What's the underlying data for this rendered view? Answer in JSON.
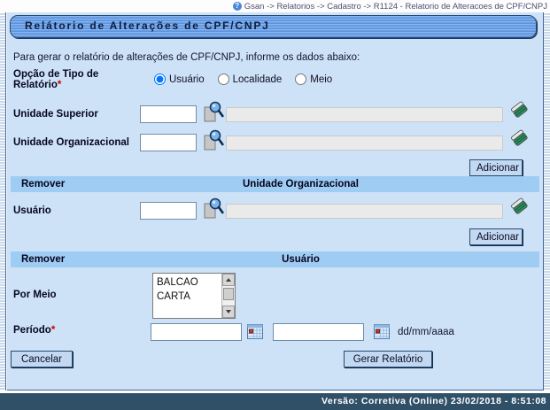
{
  "breadcrumb": {
    "text": "Gsan -> Relatorios -> Cadastro -> R1124 - Relatorio de Alteracoes de CPF/CNPJ",
    "help_glyph": "?"
  },
  "title": "Relátorio de Alterações de CPF/CNPJ",
  "intro": "Para gerar o relatório de alterações de CPF/CNPJ, informe os dados abaixo:",
  "report_type": {
    "label": "Opção de Tipo de Relatório",
    "required_mark": "*",
    "options": [
      {
        "label": "Usuário",
        "checked_attr": "checked"
      },
      {
        "label": "Localidade"
      },
      {
        "label": "Meio"
      }
    ]
  },
  "unidade_superior": {
    "label": "Unidade Superior",
    "code_value": "",
    "name_value": ""
  },
  "unidade_organizacional": {
    "label": "Unidade Organizacional",
    "code_value": "",
    "name_value": ""
  },
  "usuario": {
    "label": "Usuário",
    "code_value": "",
    "name_value": ""
  },
  "unidade_table": {
    "col_remover": "Remover",
    "col_main": "Unidade Organizacional"
  },
  "usuario_table": {
    "col_remover": "Remover",
    "col_main": "Usuário"
  },
  "por_meio": {
    "label": "Por Meio",
    "options": [
      "BALCAO",
      "CARTA"
    ]
  },
  "periodo": {
    "label": "Período",
    "required_mark": "*",
    "date_start": "",
    "date_end": "",
    "format_hint": "dd/mm/aaaa"
  },
  "actions": {
    "adicionar": "Adicionar",
    "cancelar": "Cancelar",
    "gerar_relatorio": "Gerar Relatório"
  },
  "footer": {
    "version": "Versão: Corretiva (Online) 23/02/2018 - 8:51:08"
  },
  "colors": {
    "page_bg": "#cde2f7",
    "title_bar": "#699fe5",
    "table_header": "#9fccf3",
    "version_bar": "#305068",
    "button_bg": "#c3d9f1",
    "required": "#cc0000"
  }
}
